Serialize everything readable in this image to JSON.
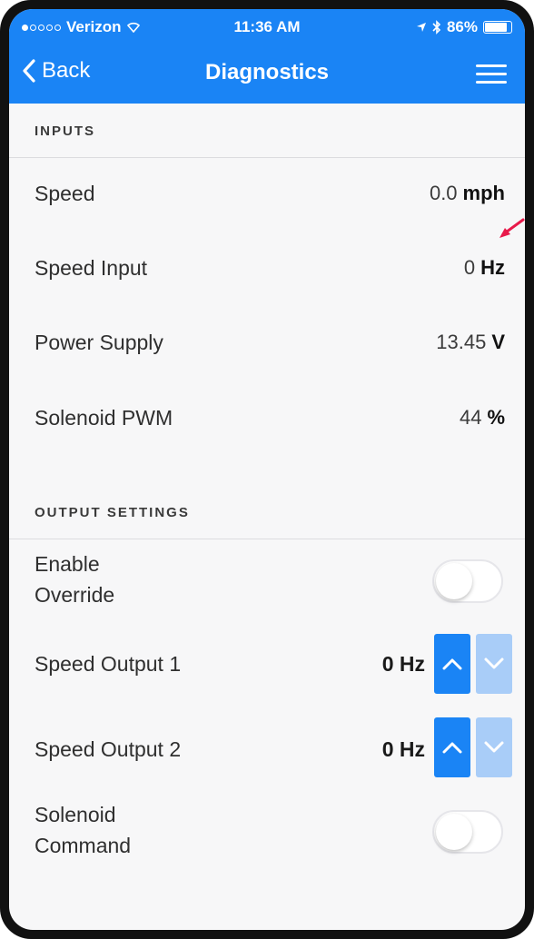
{
  "status_bar": {
    "carrier": "Verizon",
    "time": "11:36 AM",
    "battery": "86%"
  },
  "nav": {
    "back_label": "Back",
    "title": "Diagnostics"
  },
  "inputs": {
    "header": "INPUTS",
    "rows": [
      {
        "label": "Speed",
        "value": "0.0",
        "unit": "mph"
      },
      {
        "label": "Speed Input",
        "value": "0",
        "unit": "Hz"
      },
      {
        "label": "Power Supply",
        "value": "13.45",
        "unit": "V"
      },
      {
        "label": "Solenoid PWM",
        "value": "44",
        "unit": "%"
      }
    ]
  },
  "output_settings": {
    "header": "OUTPUT SETTINGS",
    "enable_override": {
      "label_line1": "Enable",
      "label_line2": "Override",
      "state": "off"
    },
    "speed_output_1": {
      "label": "Speed Output 1",
      "value": "0 Hz"
    },
    "speed_output_2": {
      "label": "Speed Output 2",
      "value": "0 Hz"
    },
    "solenoid_command": {
      "label_line1": "Solenoid",
      "label_line2": "Command",
      "state": "off"
    }
  },
  "colors": {
    "accent": "#1a84f5",
    "accent_light": "#a9cdf8",
    "annotation_arrow": "#e8194a"
  },
  "icons": {
    "back": "chevron-left-icon",
    "menu": "hamburger-menu-icon",
    "up": "chevron-up-icon",
    "down": "chevron-down-icon"
  }
}
